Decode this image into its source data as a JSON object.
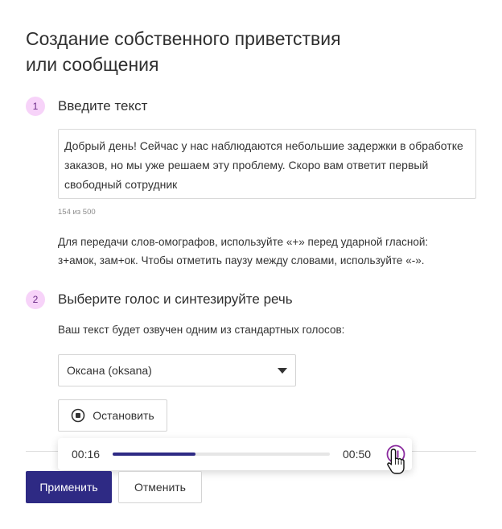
{
  "page": {
    "title_line1": "Создание собственного приветствия",
    "title_line2": "или сообщения"
  },
  "step1": {
    "number": "1",
    "title": "Введите текст",
    "text_value": "Добрый день! Сейчас у нас наблюдаются небольшие задержки в обработке заказов, но мы уже решаем эту проблему. Скоро вам ответит первый свободный сотрудник",
    "counter": "154 из 500",
    "hint_line1": "Для передачи слов-омографов, используйте «+» перед ударной гласной:",
    "hint_line2": "з+амок, зам+ок. Чтобы отметить паузу между словами, используйте «-»."
  },
  "step2": {
    "number": "2",
    "title": "Выберите голос и синтезируйте речь",
    "description": "Ваш текст будет озвучен одним из стандартных голосов:",
    "voice_selected": "Оксана (oksana)",
    "stop_label": "Остановить"
  },
  "player": {
    "current_time": "00:16",
    "total_time": "00:50",
    "progress": 0.38
  },
  "footer": {
    "apply_label": "Применить",
    "cancel_label": "Отменить"
  },
  "icons": {
    "dropdown": "chevron-down-icon",
    "stop": "stop-icon",
    "pause": "pause-icon",
    "cursor": "hand-pointer-icon"
  },
  "colors": {
    "primary": "#2e2a84",
    "step_badge_bg": "#f7d3f9",
    "step_badge_text": "#6a2a86",
    "pause_accent": "#8a2a9e"
  }
}
